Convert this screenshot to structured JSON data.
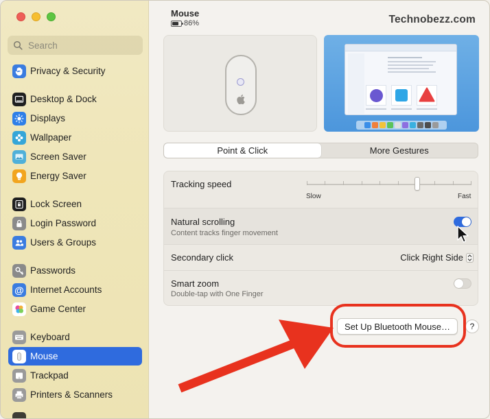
{
  "window": {
    "title": "Mouse",
    "battery": "86%",
    "watermark": "Technobezz.com"
  },
  "search": {
    "placeholder": "Search"
  },
  "sidebar": {
    "items": [
      {
        "label": "Privacy & Security",
        "icon": "hand-icon",
        "color": "#3a7ce0"
      },
      {
        "label": "Desktop & Dock",
        "icon": "dock-icon",
        "color": "#1f1f1f"
      },
      {
        "label": "Displays",
        "icon": "sun-icon",
        "color": "#2f7fe8"
      },
      {
        "label": "Wallpaper",
        "icon": "flower-icon",
        "color": "#35a6d8"
      },
      {
        "label": "Screen Saver",
        "icon": "screen-saver-icon",
        "color": "#4fb0d9"
      },
      {
        "label": "Energy Saver",
        "icon": "lightbulb-icon",
        "color": "#f2a51e"
      },
      {
        "label": "Lock Screen",
        "icon": "lock-screen-icon",
        "color": "#1f1f1f"
      },
      {
        "label": "Login Password",
        "icon": "lock-icon",
        "color": "#8a8a8a"
      },
      {
        "label": "Users & Groups",
        "icon": "users-icon",
        "color": "#3a7ce0"
      },
      {
        "label": "Passwords",
        "icon": "key-icon",
        "color": "#8a8a8a"
      },
      {
        "label": "Internet Accounts",
        "icon": "at-icon",
        "color": "#3a7ce0"
      },
      {
        "label": "Game Center",
        "icon": "game-center-icon",
        "color": "#ffffff"
      },
      {
        "label": "Keyboard",
        "icon": "keyboard-icon",
        "color": "#9a9a9a"
      },
      {
        "label": "Mouse",
        "icon": "mouse-icon",
        "color": "#ffffff",
        "active": true
      },
      {
        "label": "Trackpad",
        "icon": "trackpad-icon",
        "color": "#9a9a9a"
      },
      {
        "label": "Printers & Scanners",
        "icon": "printer-icon",
        "color": "#9a9a9a"
      }
    ]
  },
  "tabs": [
    {
      "label": "Point & Click",
      "active": true
    },
    {
      "label": "More Gestures",
      "active": false
    }
  ],
  "settings": {
    "tracking": {
      "label": "Tracking speed",
      "min_label": "Slow",
      "max_label": "Fast",
      "value": 0.67
    },
    "natural_scrolling": {
      "label": "Natural scrolling",
      "sub": "Content tracks finger movement",
      "on": true
    },
    "secondary_click": {
      "label": "Secondary click",
      "value": "Click Right Side"
    },
    "smart_zoom": {
      "label": "Smart zoom",
      "sub": "Double-tap with One Finger",
      "on": false
    }
  },
  "bluetooth_button": {
    "label": "Set Up Bluetooth Mouse…"
  },
  "help_button": {
    "label": "?"
  },
  "colors": {
    "accent": "#2f6bde",
    "annotation_red": "#e8321e"
  }
}
